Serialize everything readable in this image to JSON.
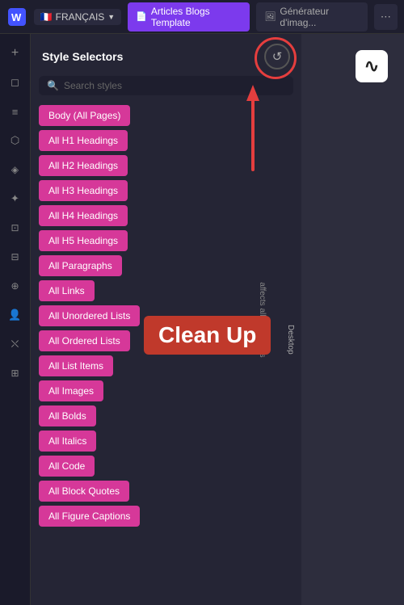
{
  "topbar": {
    "logo": "W",
    "language": "FRANÇAIS",
    "tab_active_label": "Articles Blogs Template",
    "tab_inactive_label": "Générateur d'imag...",
    "flag": "🇫🇷"
  },
  "sidebar": {
    "icons": [
      {
        "name": "plus-icon",
        "glyph": "+"
      },
      {
        "name": "page-icon",
        "glyph": "◻"
      },
      {
        "name": "menu-icon",
        "glyph": "≡"
      },
      {
        "name": "cube-icon",
        "glyph": "⬡"
      },
      {
        "name": "layers-icon",
        "glyph": "◈"
      },
      {
        "name": "drops-icon",
        "glyph": "❋"
      },
      {
        "name": "image-icon",
        "glyph": "🖼"
      },
      {
        "name": "database-icon",
        "glyph": "⊟"
      },
      {
        "name": "flow-icon",
        "glyph": "⊕"
      },
      {
        "name": "user-icon",
        "glyph": "👤"
      },
      {
        "name": "cart-icon",
        "glyph": "⛌"
      },
      {
        "name": "grid-icon",
        "glyph": "⊞"
      }
    ]
  },
  "style_panel": {
    "title": "Style Selectors",
    "search_placeholder": "Search styles",
    "panel_icon": "↺",
    "vertical_label": "affects all resolutions",
    "tags": [
      "Body (All Pages)",
      "All H1 Headings",
      "All H2 Headings",
      "All H3 Headings",
      "All H4 Headings",
      "All H5 Headings",
      "All Paragraphs",
      "All Links",
      "All Unordered Lists",
      "All Ordered Lists",
      "All List Items",
      "All Images",
      "All Bolds",
      "All Italics",
      "All Code",
      "All Block Quotes",
      "All Figure Captions"
    ]
  },
  "overlay": {
    "cleanup_label": "Clean Up",
    "desktop_label": "Desktop",
    "arrow_label": "arrow pointing up to icon"
  },
  "content": {
    "wv_logo": "∿"
  }
}
